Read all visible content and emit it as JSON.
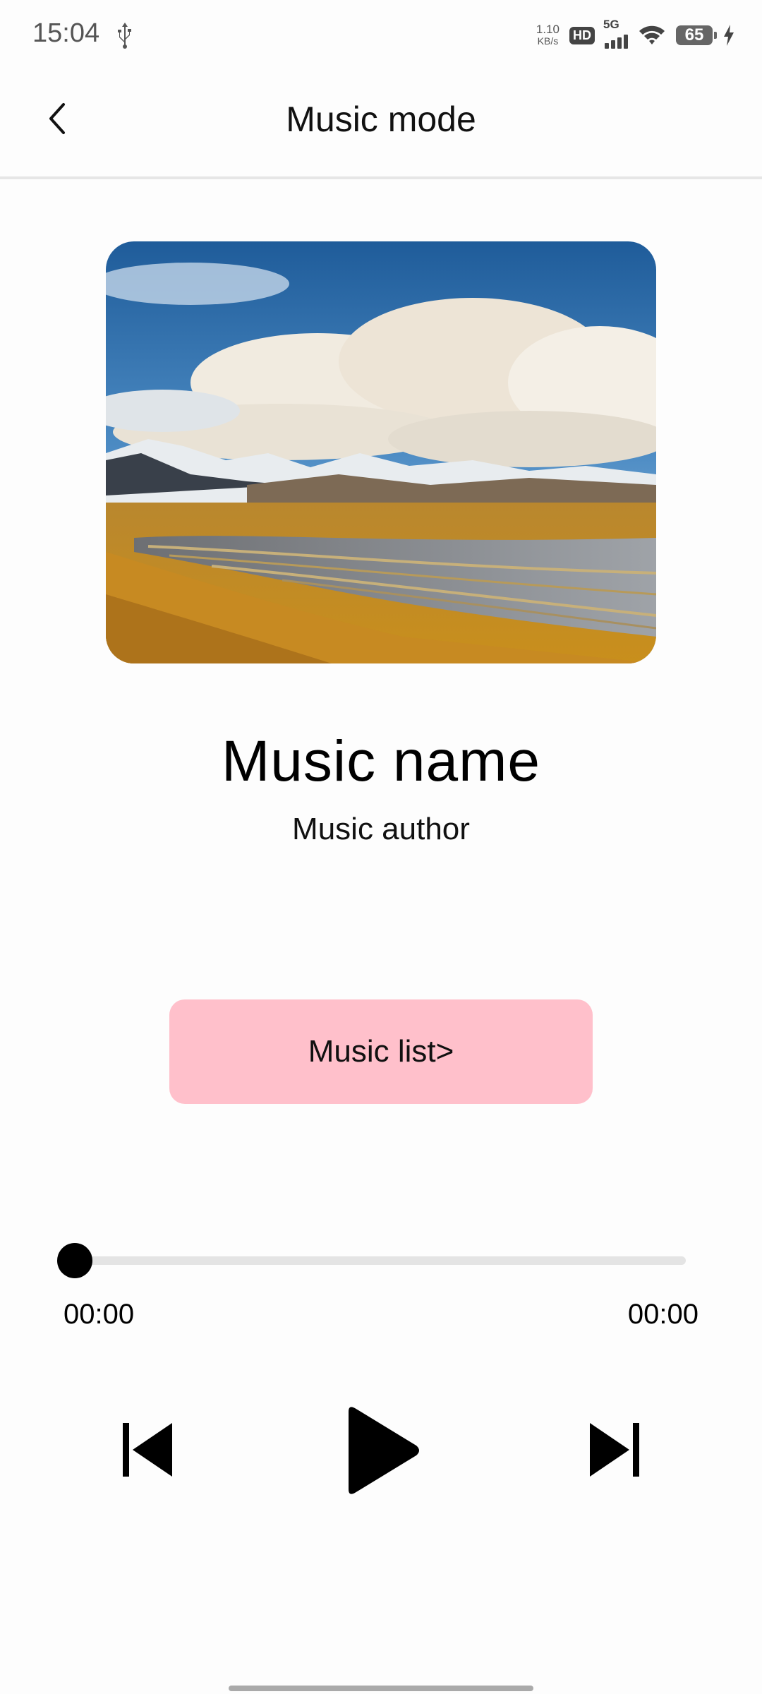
{
  "status_bar": {
    "time": "15:04",
    "net_speed_value": "1.10",
    "net_speed_unit": "KB/s",
    "hd_label": "HD",
    "network_type": "5G",
    "battery_level": "65",
    "icons": [
      "usb-icon",
      "hd-icon",
      "signal-icon",
      "wifi-icon",
      "battery-icon",
      "charging-icon"
    ]
  },
  "header": {
    "title": "Music mode",
    "back_icon": "chevron-left-icon"
  },
  "track": {
    "name": "Music name",
    "author": "Music author",
    "cover": "landscape-cover-image"
  },
  "music_list_button": {
    "label": "Music list>",
    "color": "#ffc0cb"
  },
  "progress": {
    "current_time": "00:00",
    "total_time": "00:00",
    "fraction": 0
  },
  "controls": {
    "icons": [
      "skip-previous-icon",
      "play-icon",
      "skip-next-icon"
    ]
  }
}
